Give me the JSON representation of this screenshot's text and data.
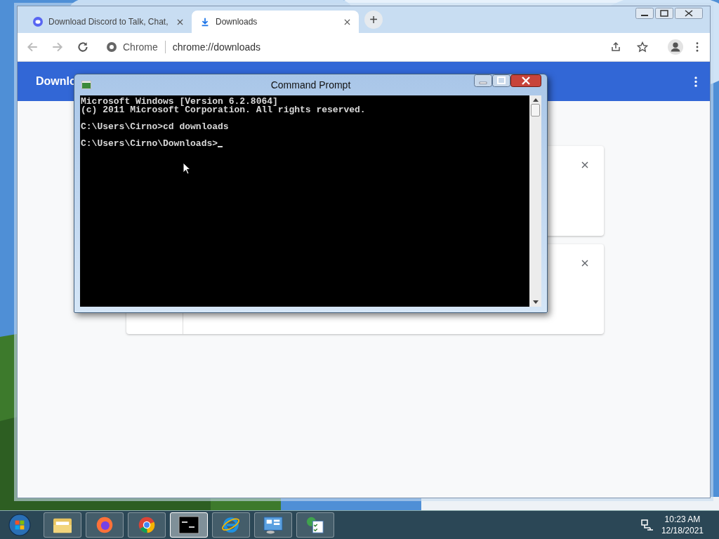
{
  "browser": {
    "tabs": [
      {
        "title": "Download Discord to Talk, Chat,",
        "selected": false
      },
      {
        "title": "Downloads",
        "selected": true
      }
    ],
    "new_tab": "+",
    "address": {
      "site": "Chrome",
      "url": "chrome://downloads"
    },
    "header": {
      "title": "Downlo"
    }
  },
  "console": {
    "title": "Command Prompt",
    "blocks": [
      [
        "Microsoft Windows [Version 6.2.8064]",
        "(c) 2011 Microsoft Corporation. All rights reserved."
      ],
      [
        "C:\\Users\\Cirno>cd downloads"
      ],
      [
        "C:\\Users\\Cirno\\Downloads>"
      ]
    ]
  },
  "taskbar": {
    "apps": [
      {
        "kind": "explorer",
        "selected": false
      },
      {
        "kind": "firefox",
        "selected": false
      },
      {
        "kind": "chrome",
        "selected": false
      },
      {
        "kind": "console",
        "selected": true
      },
      {
        "kind": "ie",
        "selected": false
      },
      {
        "kind": "control",
        "selected": false
      },
      {
        "kind": "tasks",
        "selected": false
      }
    ],
    "time": "10:23 AM",
    "date": "12/18/2021"
  }
}
